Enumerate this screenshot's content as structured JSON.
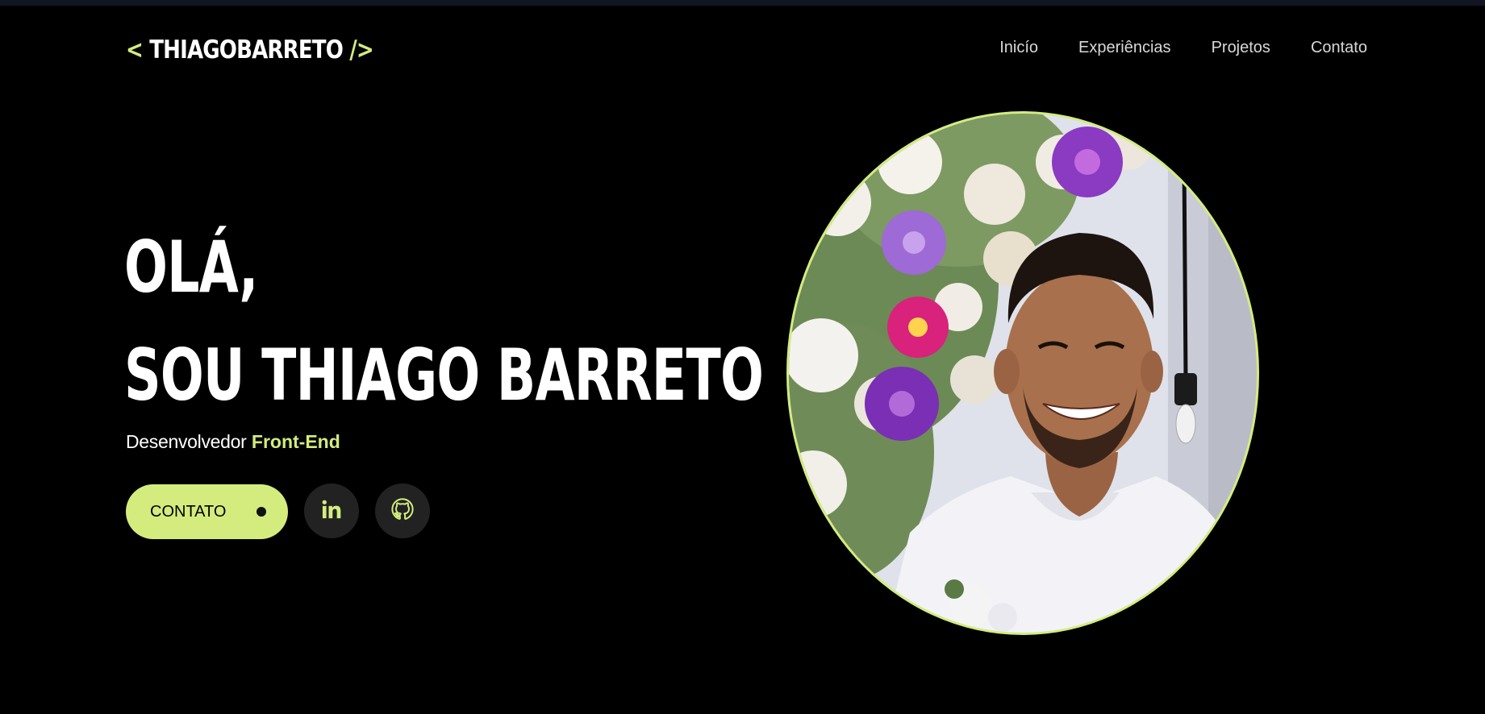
{
  "header": {
    "logo": {
      "open_tag": "< ",
      "name": "THIAGOBARRETO",
      "close_tag": " />"
    },
    "nav": [
      "Inicío",
      "Experiências",
      "Projetos",
      "Contato"
    ]
  },
  "hero": {
    "greeting": "OLÁ,",
    "intro": "SOU THIAGO BARRETO",
    "role_prefix": "Desenvolvedor",
    "role_highlight": "Front-End",
    "contact_button": "CONTATO",
    "social_icons": [
      "linkedin-icon",
      "github-icon"
    ]
  },
  "colors": {
    "accent": "#d4ec7e",
    "background": "#000000",
    "social_button_bg": "#222222"
  }
}
